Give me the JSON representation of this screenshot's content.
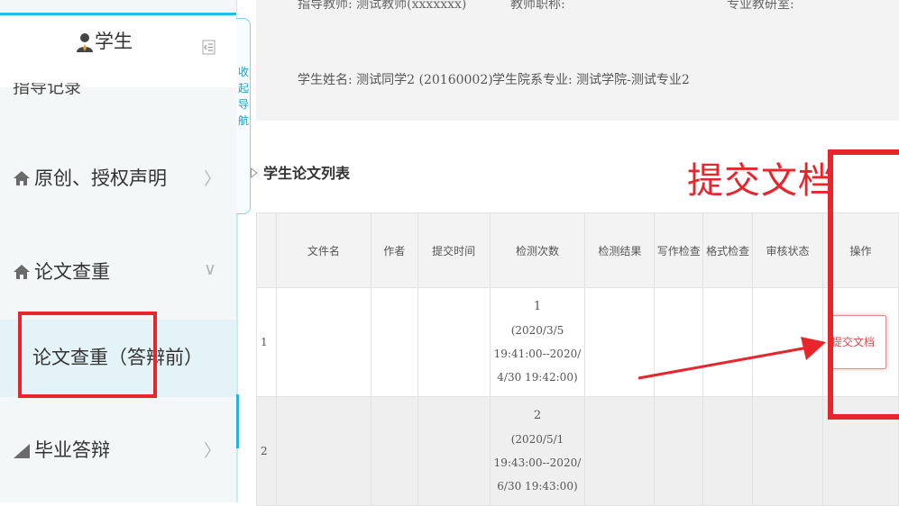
{
  "sidebar": {
    "title": "学生",
    "cut_item": "指导记录",
    "items": [
      {
        "label": "原创、授权声明",
        "icon": "home-icon",
        "arrow": "〉"
      },
      {
        "label": "论文查重",
        "icon": "home-icon",
        "arrow": "∨"
      },
      {
        "label": "毕业答辩",
        "icon": "chart-icon",
        "arrow": "〉"
      }
    ],
    "sub_item": "论文查重（答辩前）"
  },
  "collapse_tab": {
    "label": "收起导航"
  },
  "info": {
    "cut_line_1": "指导教师: 测试教师(xxxxxxx)",
    "cut_line_2": "教师职称:",
    "cut_line_3": "专业教研室:",
    "student_name": "学生姓名: 测试同学2 (20160002)",
    "student_major": "学生院系专业: 测试学院-测试专业2"
  },
  "section_title": "学生论文列表",
  "annotation_text": "提交文档",
  "table": {
    "headers": [
      "",
      "文件名",
      "作者",
      "提交时间",
      "检测次数",
      "检测结果",
      "写作检查",
      "格式检查",
      "审核状态",
      "操作"
    ],
    "rows": [
      {
        "index": "1",
        "count": "1",
        "window_a": "(2020/3/5 19:41:00--2020/",
        "window_b": "4/30 19:42:00)",
        "action": "提交文档"
      },
      {
        "index": "2",
        "count": "2",
        "window_a": "(2020/5/1 19:43:00--2020/",
        "window_b": "6/30 19:43:00)",
        "action": ""
      }
    ]
  },
  "colors": {
    "accent": "#1ec0e6",
    "annotation": "#e8252b",
    "action_text": "#e0484d"
  }
}
